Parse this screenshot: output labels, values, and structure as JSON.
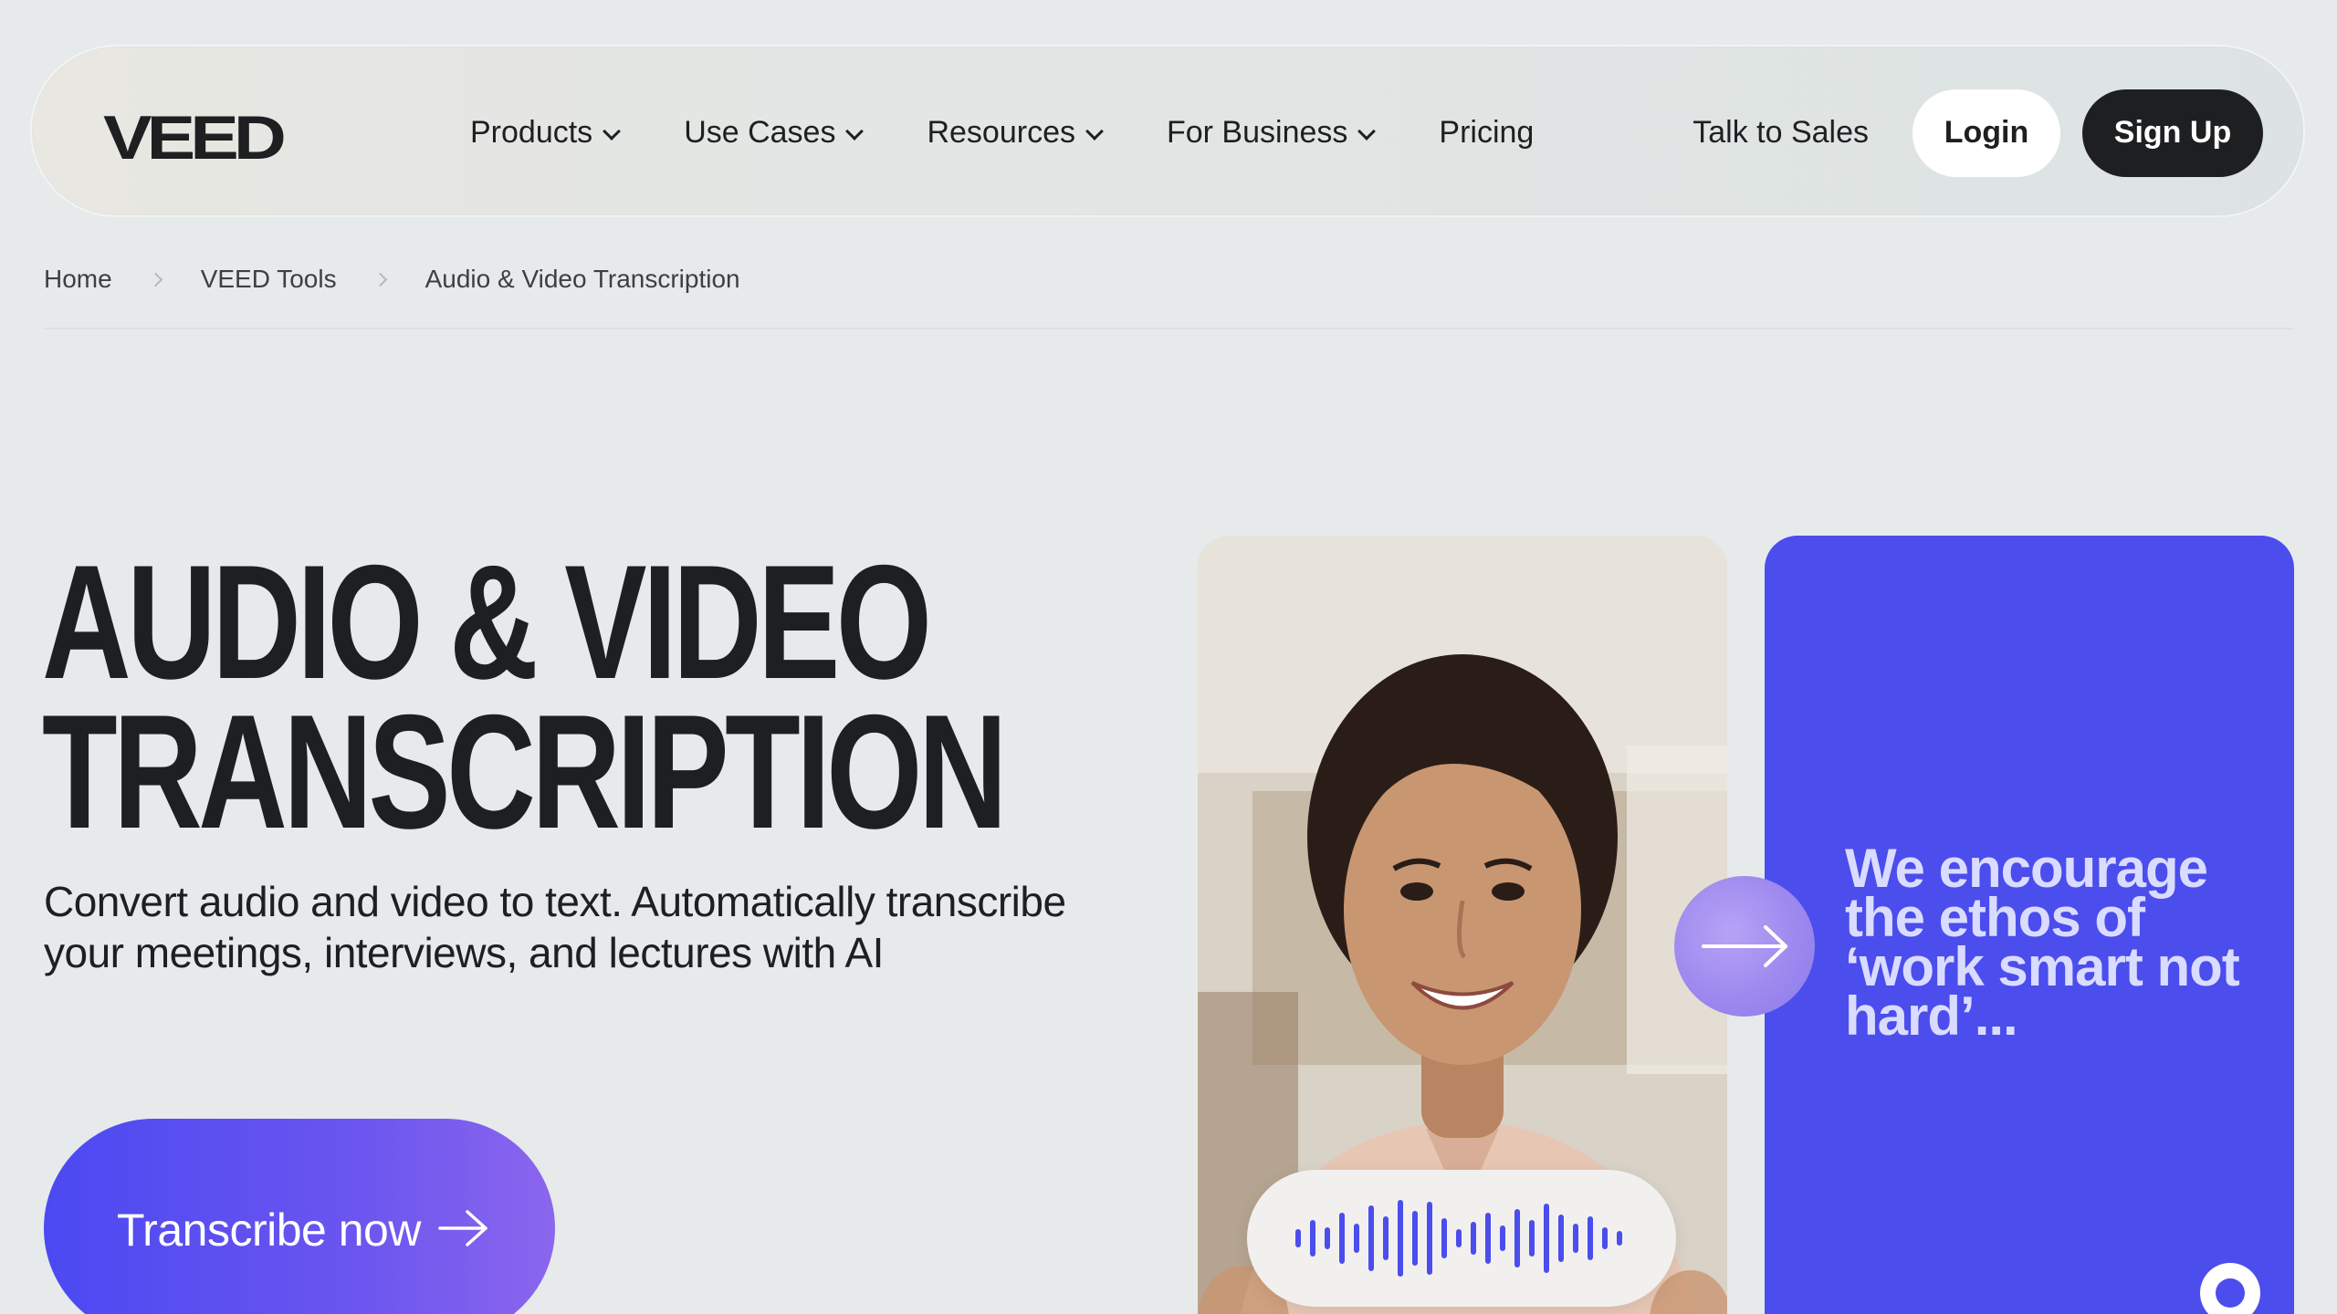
{
  "nav": {
    "logo": "VEED",
    "items": [
      {
        "label": "Products",
        "dropdown": true
      },
      {
        "label": "Use Cases",
        "dropdown": true
      },
      {
        "label": "Resources",
        "dropdown": true
      },
      {
        "label": "For Business",
        "dropdown": true
      },
      {
        "label": "Pricing",
        "dropdown": false
      }
    ],
    "talk_to_sales": "Talk to Sales",
    "login": "Login",
    "sign_up": "Sign Up"
  },
  "breadcrumb": [
    "Home",
    "VEED Tools",
    "Audio & Video Transcription"
  ],
  "hero": {
    "title_line1": "AUDIO & VIDEO",
    "title_line2": "TRANSCRIPTION",
    "subtitle": "Convert audio and video to text. Automatically transcribe your meetings, interviews, and lectures with AI",
    "cta_label": "Transcribe now"
  },
  "media": {
    "quote": "We encourage the ethos of ‘work smart not hard’...",
    "icons": [
      "arrow-right-icon",
      "audio-waveform-icon",
      "ring-icon"
    ]
  },
  "colors": {
    "background": "#e6eaea",
    "text": "#1e1f21",
    "brand_blue": "#4b4ded",
    "cta_gradient_start": "#4b49f2",
    "cta_gradient_end": "#8b66ee"
  }
}
